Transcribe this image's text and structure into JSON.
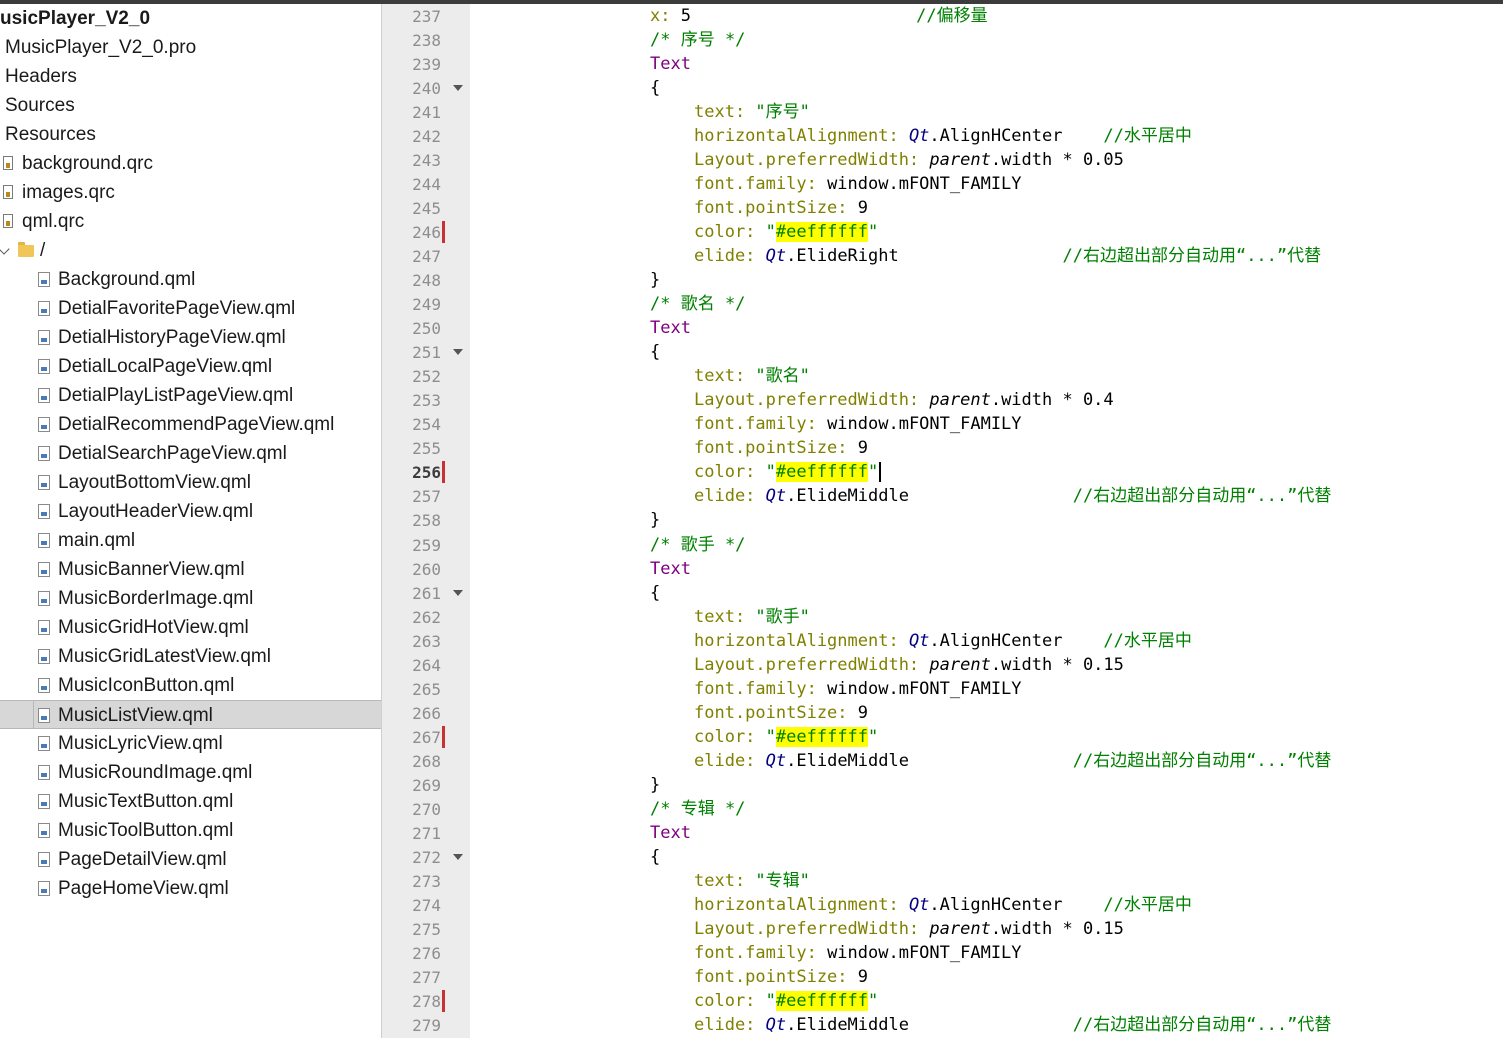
{
  "tree": {
    "project_name": "usicPlayer_V2_0",
    "items": [
      {
        "label": "MusicPlayer_V2_0.pro",
        "kind": "plain"
      },
      {
        "label": "Headers",
        "kind": "plain"
      },
      {
        "label": "Sources",
        "kind": "plain"
      },
      {
        "label": "Resources",
        "kind": "plain"
      },
      {
        "label": "background.qrc",
        "kind": "qrc"
      },
      {
        "label": "images.qrc",
        "kind": "qrc"
      },
      {
        "label": "qml.qrc",
        "kind": "qrc"
      },
      {
        "label": "/",
        "kind": "folder"
      },
      {
        "label": "Background.qml",
        "kind": "qml"
      },
      {
        "label": "DetialFavoritePageView.qml",
        "kind": "qml"
      },
      {
        "label": "DetialHistoryPageView.qml",
        "kind": "qml"
      },
      {
        "label": "DetialLocalPageView.qml",
        "kind": "qml"
      },
      {
        "label": "DetialPlayListPageView.qml",
        "kind": "qml"
      },
      {
        "label": "DetialRecommendPageView.qml",
        "kind": "qml"
      },
      {
        "label": "DetialSearchPageView.qml",
        "kind": "qml"
      },
      {
        "label": "LayoutBottomView.qml",
        "kind": "qml"
      },
      {
        "label": "LayoutHeaderView.qml",
        "kind": "qml"
      },
      {
        "label": "main.qml",
        "kind": "qml"
      },
      {
        "label": "MusicBannerView.qml",
        "kind": "qml"
      },
      {
        "label": "MusicBorderImage.qml",
        "kind": "qml"
      },
      {
        "label": "MusicGridHotView.qml",
        "kind": "qml"
      },
      {
        "label": "MusicGridLatestView.qml",
        "kind": "qml"
      },
      {
        "label": "MusicIconButton.qml",
        "kind": "qml"
      },
      {
        "label": "MusicListView.qml",
        "kind": "qml",
        "selected": true
      },
      {
        "label": "MusicLyricView.qml",
        "kind": "qml"
      },
      {
        "label": "MusicRoundImage.qml",
        "kind": "qml"
      },
      {
        "label": "MusicTextButton.qml",
        "kind": "qml"
      },
      {
        "label": "MusicToolButton.qml",
        "kind": "qml"
      },
      {
        "label": "PageDetailView.qml",
        "kind": "qml"
      },
      {
        "label": "PageHomeView.qml",
        "kind": "qml"
      }
    ]
  },
  "editor": {
    "current_line": "256",
    "lines": [
      {
        "n": "237",
        "indent": 0,
        "tokens": [
          [
            "kw",
            "x: "
          ],
          [
            "",
            "5"
          ],
          [
            "cmt",
            "                      //偏移量"
          ]
        ]
      },
      {
        "n": "238",
        "indent": 0,
        "tokens": [
          [
            "cmt",
            "/* 序号 */"
          ]
        ]
      },
      {
        "n": "239",
        "indent": 0,
        "tokens": [
          [
            "type",
            "Text"
          ]
        ]
      },
      {
        "n": "240",
        "indent": 0,
        "fold": true,
        "tokens": [
          [
            "",
            "{"
          ]
        ]
      },
      {
        "n": "241",
        "indent": 1,
        "tokens": [
          [
            "kw",
            "text: "
          ],
          [
            "str",
            "\"序号\""
          ]
        ]
      },
      {
        "n": "242",
        "indent": 1,
        "tokens": [
          [
            "kw",
            "horizontalAlignment: "
          ],
          [
            "qt",
            "Qt"
          ],
          [
            "",
            ".AlignHCenter    "
          ],
          [
            "cmt",
            "//水平居中"
          ]
        ]
      },
      {
        "n": "243",
        "indent": 1,
        "tokens": [
          [
            "kw",
            "Layout.preferredWidth: "
          ],
          [
            "it",
            "parent"
          ],
          [
            "",
            ".width * 0.05"
          ]
        ]
      },
      {
        "n": "244",
        "indent": 1,
        "tokens": [
          [
            "kw",
            "font.family: "
          ],
          [
            "",
            "window.mFONT_FAMILY"
          ]
        ]
      },
      {
        "n": "245",
        "indent": 1,
        "tokens": [
          [
            "kw",
            "font.pointSize: "
          ],
          [
            "",
            "9"
          ]
        ]
      },
      {
        "n": "246",
        "indent": 1,
        "marker": true,
        "tokens": [
          [
            "kw",
            "color: "
          ],
          [
            "str",
            "\""
          ],
          [
            "hl",
            "#eeffffff"
          ],
          [
            "str",
            "\""
          ]
        ]
      },
      {
        "n": "247",
        "indent": 1,
        "tokens": [
          [
            "kw",
            "elide: "
          ],
          [
            "qt",
            "Qt"
          ],
          [
            "",
            ".ElideRight                "
          ],
          [
            "cmt",
            "//右边超出部分自动用“...”代替"
          ]
        ]
      },
      {
        "n": "248",
        "indent": 0,
        "tokens": [
          [
            "",
            "}"
          ]
        ]
      },
      {
        "n": "249",
        "indent": 0,
        "tokens": [
          [
            "cmt",
            "/* 歌名 */"
          ]
        ]
      },
      {
        "n": "250",
        "indent": 0,
        "tokens": [
          [
            "type",
            "Text"
          ]
        ]
      },
      {
        "n": "251",
        "indent": 0,
        "fold": true,
        "tokens": [
          [
            "",
            "{"
          ]
        ]
      },
      {
        "n": "252",
        "indent": 1,
        "tokens": [
          [
            "kw",
            "text: "
          ],
          [
            "str",
            "\"歌名\""
          ]
        ]
      },
      {
        "n": "253",
        "indent": 1,
        "tokens": [
          [
            "kw",
            "Layout.preferredWidth: "
          ],
          [
            "it",
            "parent"
          ],
          [
            "",
            ".width * 0.4"
          ]
        ]
      },
      {
        "n": "254",
        "indent": 1,
        "tokens": [
          [
            "kw",
            "font.family: "
          ],
          [
            "",
            "window.mFONT_FAMILY"
          ]
        ]
      },
      {
        "n": "255",
        "indent": 1,
        "tokens": [
          [
            "kw",
            "font.pointSize: "
          ],
          [
            "",
            "9"
          ]
        ]
      },
      {
        "n": "256",
        "indent": 1,
        "marker": true,
        "caret": true,
        "tokens": [
          [
            "kw",
            "color: "
          ],
          [
            "str",
            "\""
          ],
          [
            "hl",
            "#eeffffff"
          ],
          [
            "str",
            "\""
          ]
        ]
      },
      {
        "n": "257",
        "indent": 1,
        "tokens": [
          [
            "kw",
            "elide: "
          ],
          [
            "qt",
            "Qt"
          ],
          [
            "",
            ".ElideMiddle                "
          ],
          [
            "cmt",
            "//右边超出部分自动用“...”代替"
          ]
        ]
      },
      {
        "n": "258",
        "indent": 0,
        "tokens": [
          [
            "",
            "}"
          ]
        ]
      },
      {
        "n": "259",
        "indent": 0,
        "tokens": [
          [
            "cmt",
            "/* 歌手 */"
          ]
        ]
      },
      {
        "n": "260",
        "indent": 0,
        "tokens": [
          [
            "type",
            "Text"
          ]
        ]
      },
      {
        "n": "261",
        "indent": 0,
        "fold": true,
        "tokens": [
          [
            "",
            "{"
          ]
        ]
      },
      {
        "n": "262",
        "indent": 1,
        "tokens": [
          [
            "kw",
            "text: "
          ],
          [
            "str",
            "\"歌手\""
          ]
        ]
      },
      {
        "n": "263",
        "indent": 1,
        "tokens": [
          [
            "kw",
            "horizontalAlignment: "
          ],
          [
            "qt",
            "Qt"
          ],
          [
            "",
            ".AlignHCenter    "
          ],
          [
            "cmt",
            "//水平居中"
          ]
        ]
      },
      {
        "n": "264",
        "indent": 1,
        "tokens": [
          [
            "kw",
            "Layout.preferredWidth: "
          ],
          [
            "it",
            "parent"
          ],
          [
            "",
            ".width * 0.15"
          ]
        ]
      },
      {
        "n": "265",
        "indent": 1,
        "tokens": [
          [
            "kw",
            "font.family: "
          ],
          [
            "",
            "window.mFONT_FAMILY"
          ]
        ]
      },
      {
        "n": "266",
        "indent": 1,
        "tokens": [
          [
            "kw",
            "font.pointSize: "
          ],
          [
            "",
            "9"
          ]
        ]
      },
      {
        "n": "267",
        "indent": 1,
        "marker": true,
        "tokens": [
          [
            "kw",
            "color: "
          ],
          [
            "str",
            "\""
          ],
          [
            "hl",
            "#eeffffff"
          ],
          [
            "str",
            "\""
          ]
        ]
      },
      {
        "n": "268",
        "indent": 1,
        "tokens": [
          [
            "kw",
            "elide: "
          ],
          [
            "qt",
            "Qt"
          ],
          [
            "",
            ".ElideMiddle                "
          ],
          [
            "cmt",
            "//右边超出部分自动用“...”代替"
          ]
        ]
      },
      {
        "n": "269",
        "indent": 0,
        "tokens": [
          [
            "",
            "}"
          ]
        ]
      },
      {
        "n": "270",
        "indent": 0,
        "tokens": [
          [
            "cmt",
            "/* 专辑 */"
          ]
        ]
      },
      {
        "n": "271",
        "indent": 0,
        "tokens": [
          [
            "type",
            "Text"
          ]
        ]
      },
      {
        "n": "272",
        "indent": 0,
        "fold": true,
        "tokens": [
          [
            "",
            "{"
          ]
        ]
      },
      {
        "n": "273",
        "indent": 1,
        "tokens": [
          [
            "kw",
            "text: "
          ],
          [
            "str",
            "\"专辑\""
          ]
        ]
      },
      {
        "n": "274",
        "indent": 1,
        "tokens": [
          [
            "kw",
            "horizontalAlignment: "
          ],
          [
            "qt",
            "Qt"
          ],
          [
            "",
            ".AlignHCenter    "
          ],
          [
            "cmt",
            "//水平居中"
          ]
        ]
      },
      {
        "n": "275",
        "indent": 1,
        "tokens": [
          [
            "kw",
            "Layout.preferredWidth: "
          ],
          [
            "it",
            "parent"
          ],
          [
            "",
            ".width * 0.15"
          ]
        ]
      },
      {
        "n": "276",
        "indent": 1,
        "tokens": [
          [
            "kw",
            "font.family: "
          ],
          [
            "",
            "window.mFONT_FAMILY"
          ]
        ]
      },
      {
        "n": "277",
        "indent": 1,
        "tokens": [
          [
            "kw",
            "font.pointSize: "
          ],
          [
            "",
            "9"
          ]
        ]
      },
      {
        "n": "278",
        "indent": 1,
        "marker": true,
        "tokens": [
          [
            "kw",
            "color: "
          ],
          [
            "str",
            "\""
          ],
          [
            "hl",
            "#eeffffff"
          ],
          [
            "str",
            "\""
          ]
        ]
      },
      {
        "n": "279",
        "indent": 1,
        "tokens": [
          [
            "kw",
            "elide: "
          ],
          [
            "qt",
            "Qt"
          ],
          [
            "",
            ".ElideMiddle                "
          ],
          [
            "cmt",
            "//右边超出部分自动用“...”代替"
          ]
        ]
      }
    ]
  }
}
